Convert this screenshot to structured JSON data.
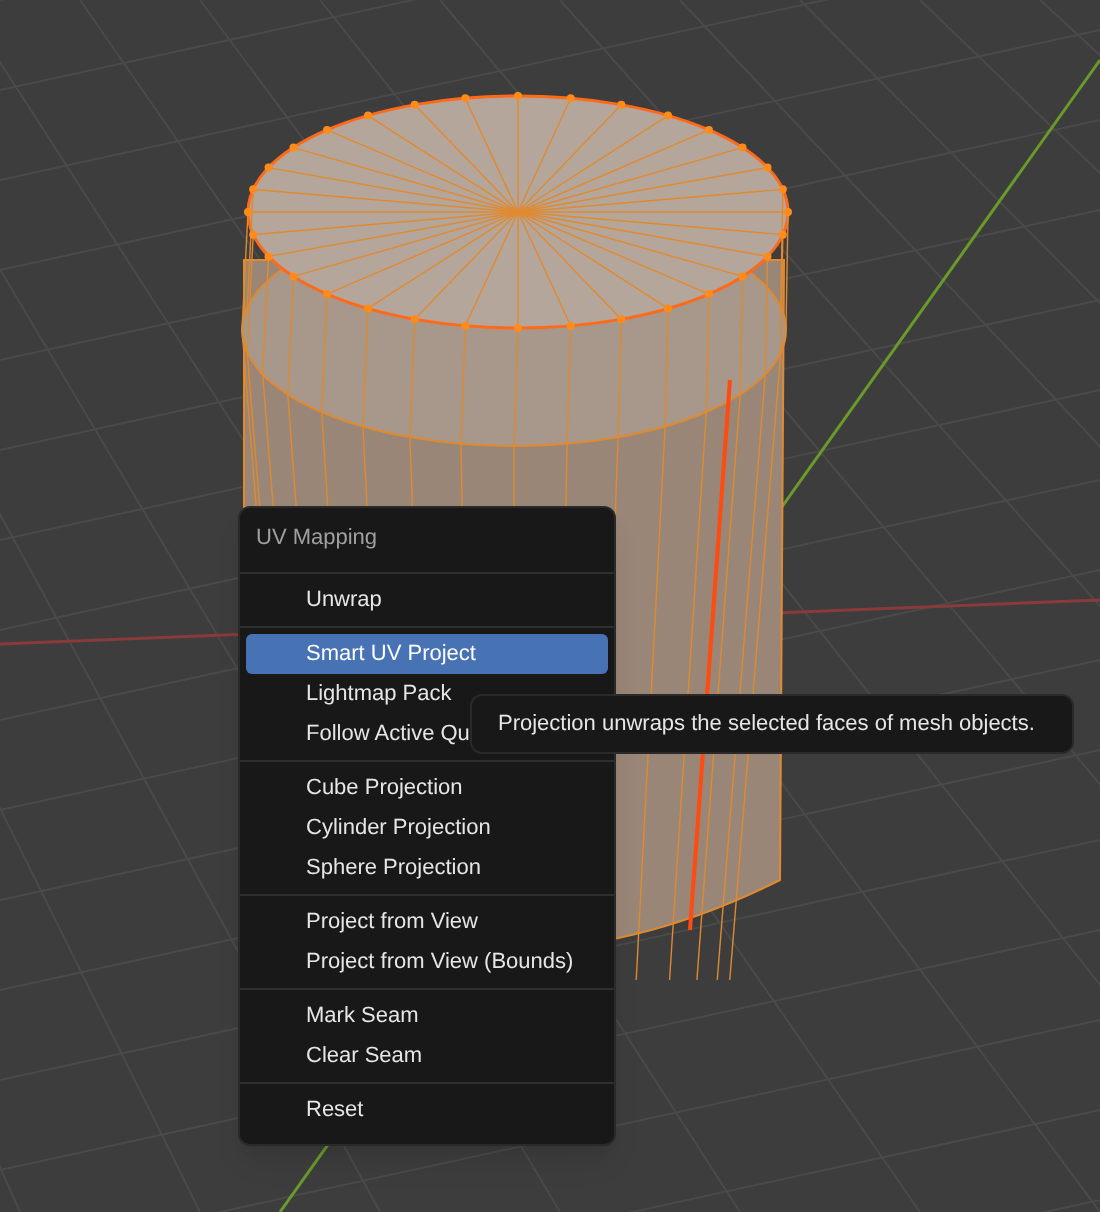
{
  "menu": {
    "title": "UV Mapping",
    "groups": [
      [
        {
          "label": "Unwrap",
          "selected": false
        }
      ],
      [
        {
          "label": "Smart UV Project",
          "selected": true
        },
        {
          "label": "Lightmap Pack",
          "selected": false
        },
        {
          "label": "Follow Active Qu",
          "selected": false
        }
      ],
      [
        {
          "label": "Cube Projection",
          "selected": false
        },
        {
          "label": "Cylinder Projection",
          "selected": false
        },
        {
          "label": "Sphere Projection",
          "selected": false
        }
      ],
      [
        {
          "label": "Project from View",
          "selected": false
        },
        {
          "label": "Project from View (Bounds)",
          "selected": false
        }
      ],
      [
        {
          "label": "Mark Seam",
          "selected": false
        },
        {
          "label": "Clear Seam",
          "selected": false
        }
      ],
      [
        {
          "label": "Reset",
          "selected": false
        }
      ]
    ]
  },
  "tooltip": {
    "text": "Projection unwraps the selected faces of mesh objects."
  }
}
